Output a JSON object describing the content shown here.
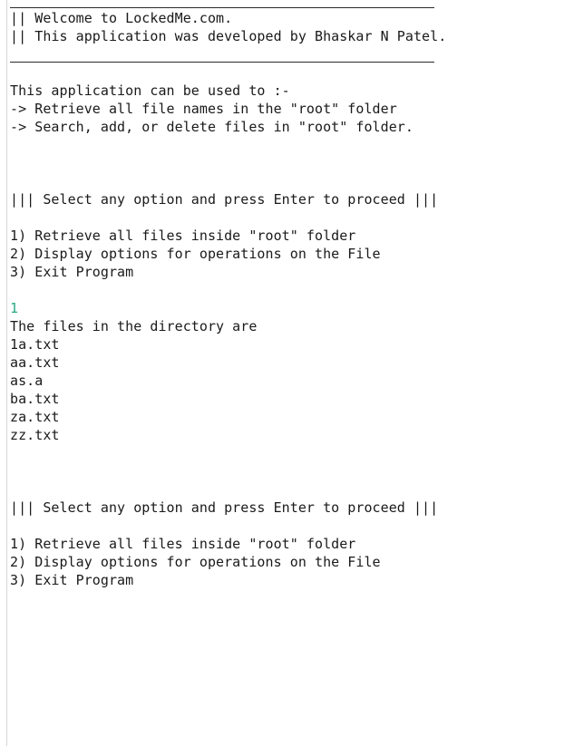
{
  "header": {
    "welcome": "|| Welcome to LockedMe.com.",
    "developer": "|| This application was developed by Bhaskar N Patel."
  },
  "intro": {
    "title": "This application can be used to :-",
    "item1": "-> Retrieve all file names in the \"root\" folder",
    "item2": "-> Search, add, or delete files in \"root\" folder."
  },
  "menu1": {
    "prompt": "||| Select any option and press Enter to proceed |||",
    "options": [
      "1) Retrieve all files inside \"root\" folder",
      "2) Display options for operations on the File",
      "3) Exit Program"
    ]
  },
  "user_input": "1",
  "listing": {
    "header": "The files in the directory are",
    "files": [
      "1a.txt",
      "aa.txt",
      "as.a",
      "ba.txt",
      "za.txt",
      "zz.txt"
    ]
  },
  "menu2": {
    "prompt": "||| Select any option and press Enter to proceed |||",
    "options": [
      "1) Retrieve all files inside \"root\" folder",
      "2) Display options for operations on the File",
      "3) Exit Program"
    ]
  },
  "colors": {
    "text": "#1a1a1a",
    "input": "#2aa886",
    "background": "#ffffff"
  }
}
